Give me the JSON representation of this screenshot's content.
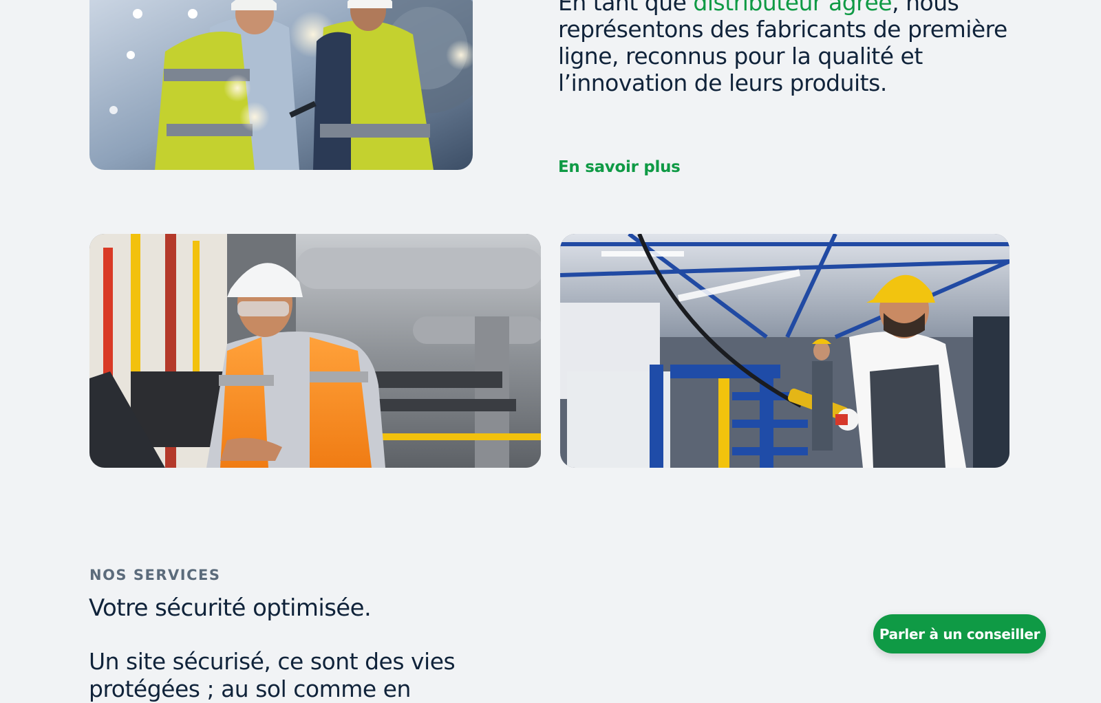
{
  "intro": {
    "text_before": "En tant que ",
    "highlight": "distributeur agréé",
    "text_after": ", nous représentons des fabricants de première ligne, reconnus pour la qualité et l’innovation de leurs produits.",
    "link_label": "En savoir plus"
  },
  "services": {
    "eyebrow": "NOS SERVICES",
    "title": "Votre sécurité optimisée.",
    "lead": "Un site sécurisé, ce sont des vies protégées ; au sol comme en"
  },
  "cta": {
    "label": "Parler à un conseiller"
  },
  "colors": {
    "accent": "#0f9a45",
    "text": "#10233a",
    "muted": "#5b6b7b",
    "background": "#f1f3f5"
  }
}
